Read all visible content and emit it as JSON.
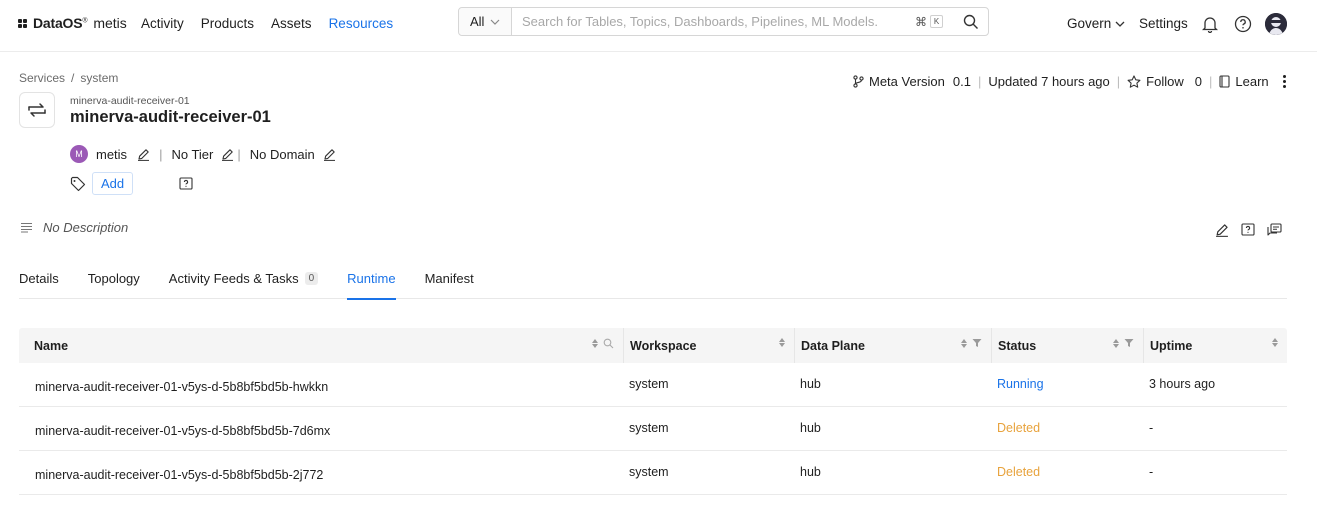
{
  "app": {
    "brand": "DataOS",
    "brand_mark": "®",
    "brand_sub": "metis"
  },
  "nav": {
    "links": [
      {
        "label": "Activity",
        "active": false
      },
      {
        "label": "Products",
        "active": false
      },
      {
        "label": "Assets",
        "active": false
      },
      {
        "label": "Resources",
        "active": true
      }
    ],
    "search": {
      "filter": "All",
      "placeholder": "Search for Tables, Topics, Dashboards, Pipelines, ML Models.",
      "shortcut_cmd": "⌘",
      "shortcut_key": "K"
    },
    "govern": "Govern",
    "settings": "Settings"
  },
  "breadcrumb": [
    "Services",
    "/",
    "system"
  ],
  "entity": {
    "subtitle": "minerva-audit-receiver-01",
    "title": "minerva-audit-receiver-01",
    "owner_initial": "M",
    "owner": "metis",
    "tier": "No Tier",
    "domain": "No Domain",
    "add_tag": "Add",
    "description": "No Description"
  },
  "meta": {
    "version_label": "Meta Version",
    "version": "0.1",
    "updated": "Updated 7 hours ago",
    "follow_label": "Follow",
    "follow_count": "0",
    "learn": "Learn"
  },
  "tabs": [
    {
      "label": "Details",
      "active": false
    },
    {
      "label": "Topology",
      "active": false
    },
    {
      "label": "Activity Feeds & Tasks",
      "count": "0",
      "active": false
    },
    {
      "label": "Runtime",
      "active": true
    },
    {
      "label": "Manifest",
      "active": false
    }
  ],
  "table": {
    "columns": [
      "Name",
      "Workspace",
      "Data Plane",
      "Status",
      "Uptime"
    ],
    "rows": [
      {
        "name": "minerva-audit-receiver-01-v5ys-d-5b8bf5bd5b-hwkkn",
        "workspace": "system",
        "plane": "hub",
        "status": "Running",
        "uptime": "3 hours ago"
      },
      {
        "name": "minerva-audit-receiver-01-v5ys-d-5b8bf5bd5b-7d6mx",
        "workspace": "system",
        "plane": "hub",
        "status": "Deleted",
        "uptime": "-"
      },
      {
        "name": "minerva-audit-receiver-01-v5ys-d-5b8bf5bd5b-2j772",
        "workspace": "system",
        "plane": "hub",
        "status": "Deleted",
        "uptime": "-"
      }
    ]
  },
  "colors": {
    "accent": "#1a73e8",
    "running": "#1a73e8",
    "deleted": "#e8a33d",
    "owner_avatar": "#9b59b6"
  },
  "icons": [
    "search-icon",
    "bell-icon",
    "help-icon",
    "chevron-down-icon",
    "branch-icon",
    "star-icon",
    "book-icon",
    "kebab-icon",
    "swap-icon",
    "pencil-icon",
    "tag-icon",
    "question-icon",
    "description-icon",
    "sort-icon",
    "filter-icon"
  ]
}
